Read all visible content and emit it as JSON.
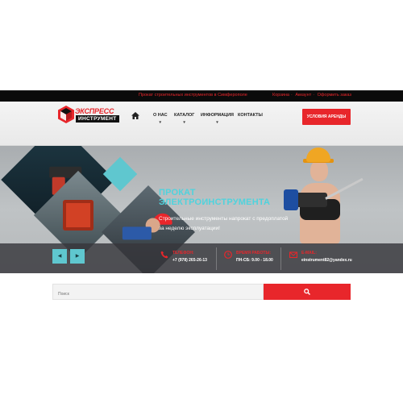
{
  "topbar": {
    "tagline": "Прокат строительных инструментов в Симферополе",
    "links": [
      "Корзина",
      "Аккаунт",
      "Оформить заказ"
    ],
    "separator": "·"
  },
  "logo": {
    "word1": "ЭКСПРЕСС",
    "word2": "ИНСТРУМЕНТ"
  },
  "nav": {
    "home_icon": "home-icon",
    "items": [
      {
        "label": "О НАС",
        "caret": "▾"
      },
      {
        "label": "КАТАЛОГ",
        "caret": "▾"
      },
      {
        "label": "ИНФОРМАЦИЯ",
        "caret": "▾"
      },
      {
        "label": "КОНТАКТЫ",
        "caret": ""
      }
    ]
  },
  "cta": {
    "label": "УСЛОВИЯ АРЕНДЫ"
  },
  "hero": {
    "title_line1": "ПРОКАТ",
    "title_line2": "ЭЛЕКТРОИНСТРУМЕНТА",
    "subtitle_line1": "Строительные инструменты напрокат с предоплатой",
    "subtitle_line2": "за неделю эксплуатации!",
    "prev_label": "◀",
    "next_label": "▶",
    "contacts": [
      {
        "icon": "phone-icon",
        "label": "ТЕЛЕФОН:",
        "value": "+7 (978) 265-26-13"
      },
      {
        "icon": "clock-icon",
        "label": "ВРЕМЯ РАБОТЫ:",
        "value": "ПН-СБ: 9.00 - 18.00"
      },
      {
        "icon": "mail-icon",
        "label": "E-MAIL:",
        "value": "einstrument82@yandex.ru"
      }
    ]
  },
  "search": {
    "placeholder": "Поиск",
    "button_icon": "search-icon"
  },
  "colors": {
    "accent": "#e8262b",
    "teal": "#5fc7cf",
    "dark": "#0b0b0b"
  }
}
